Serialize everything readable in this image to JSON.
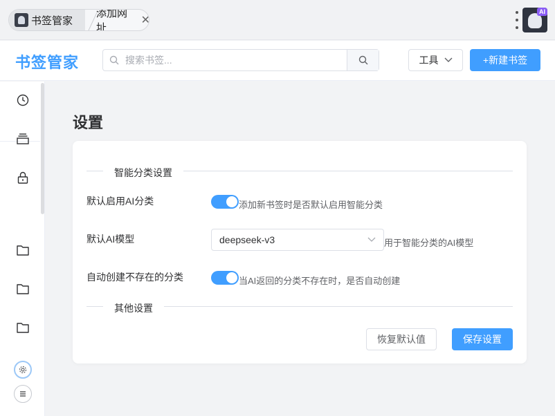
{
  "browser": {
    "tabs": [
      {
        "label": "书签管家",
        "favicon": "bookmark-app-favicon"
      },
      {
        "label": "添加网址",
        "close_icon": "close-icon"
      }
    ],
    "menu_icon": "kebab-menu-icon",
    "avatar_badge": "AI"
  },
  "header": {
    "logo": "书签管家",
    "search": {
      "placeholder": "搜索书签...",
      "value": ""
    },
    "tools_label": "工具",
    "new_label": "+新建书签"
  },
  "sidebar": {
    "icons": [
      "clock-icon",
      "stack-icon",
      "lock-icon",
      "folder-icon",
      "folder-icon",
      "folder-icon",
      "gear-icon",
      "list-icon"
    ]
  },
  "settings": {
    "page_title": "设置",
    "section_ai": "智能分类设置",
    "row_enable_ai": {
      "label": "默认启用AI分类",
      "hint": "添加新书签时是否默认启用智能分类",
      "enabled": true
    },
    "row_model": {
      "label": "默认AI模型",
      "value": "deepseek-v3",
      "hint": "用于智能分类的AI模型"
    },
    "row_auto_create": {
      "label": "自动创建不存在的分类",
      "hint": "当AI返回的分类不存在时，是否自动创建",
      "enabled": true
    },
    "section_other": "其他设置",
    "reset_label": "恢复默认值",
    "save_label": "保存设置"
  },
  "colors": {
    "primary": "#409eff",
    "text": "#303133",
    "muted": "#606266"
  }
}
